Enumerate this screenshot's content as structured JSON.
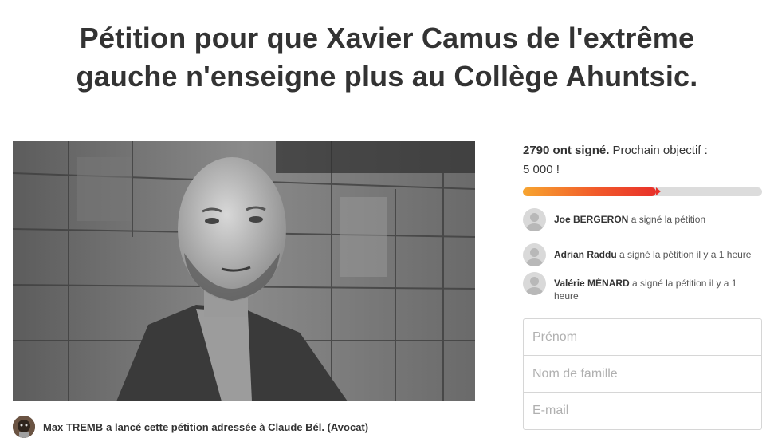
{
  "petition": {
    "title": "Pétition pour que Xavier Camus de l'extrême gauche n'enseigne plus au Collège Ahuntsic."
  },
  "starter": {
    "name": "Max TREMB",
    "action_text": "a lancé cette pétition adressée à Claude Bél. (Avocat)"
  },
  "stats": {
    "signed_count": "2790 ont signé.",
    "next_goal_text": "Prochain objectif :",
    "goal": "5 000 !",
    "progress_fraction": 0.558
  },
  "recent_signers": [
    {
      "name": "Joe BERGERON",
      "action": "a signé la pétition"
    },
    {
      "name": "Adrian Raddu",
      "action": "a signé la pétition il y a 1 heure"
    },
    {
      "name": "Valérie MÉNARD",
      "action": "a signé la pétition il y a 1 heure"
    }
  ],
  "form": {
    "first_name_placeholder": "Prénom",
    "last_name_placeholder": "Nom de famille",
    "email_placeholder": "E-mail"
  },
  "colors": {
    "progress_start": "#f7a530",
    "progress_end": "#e8312a",
    "progress_track": "#dcdcdc"
  },
  "icons": {
    "signer_avatar": "default-user-avatar-icon",
    "starter_avatar": "user-photo-avatar"
  }
}
